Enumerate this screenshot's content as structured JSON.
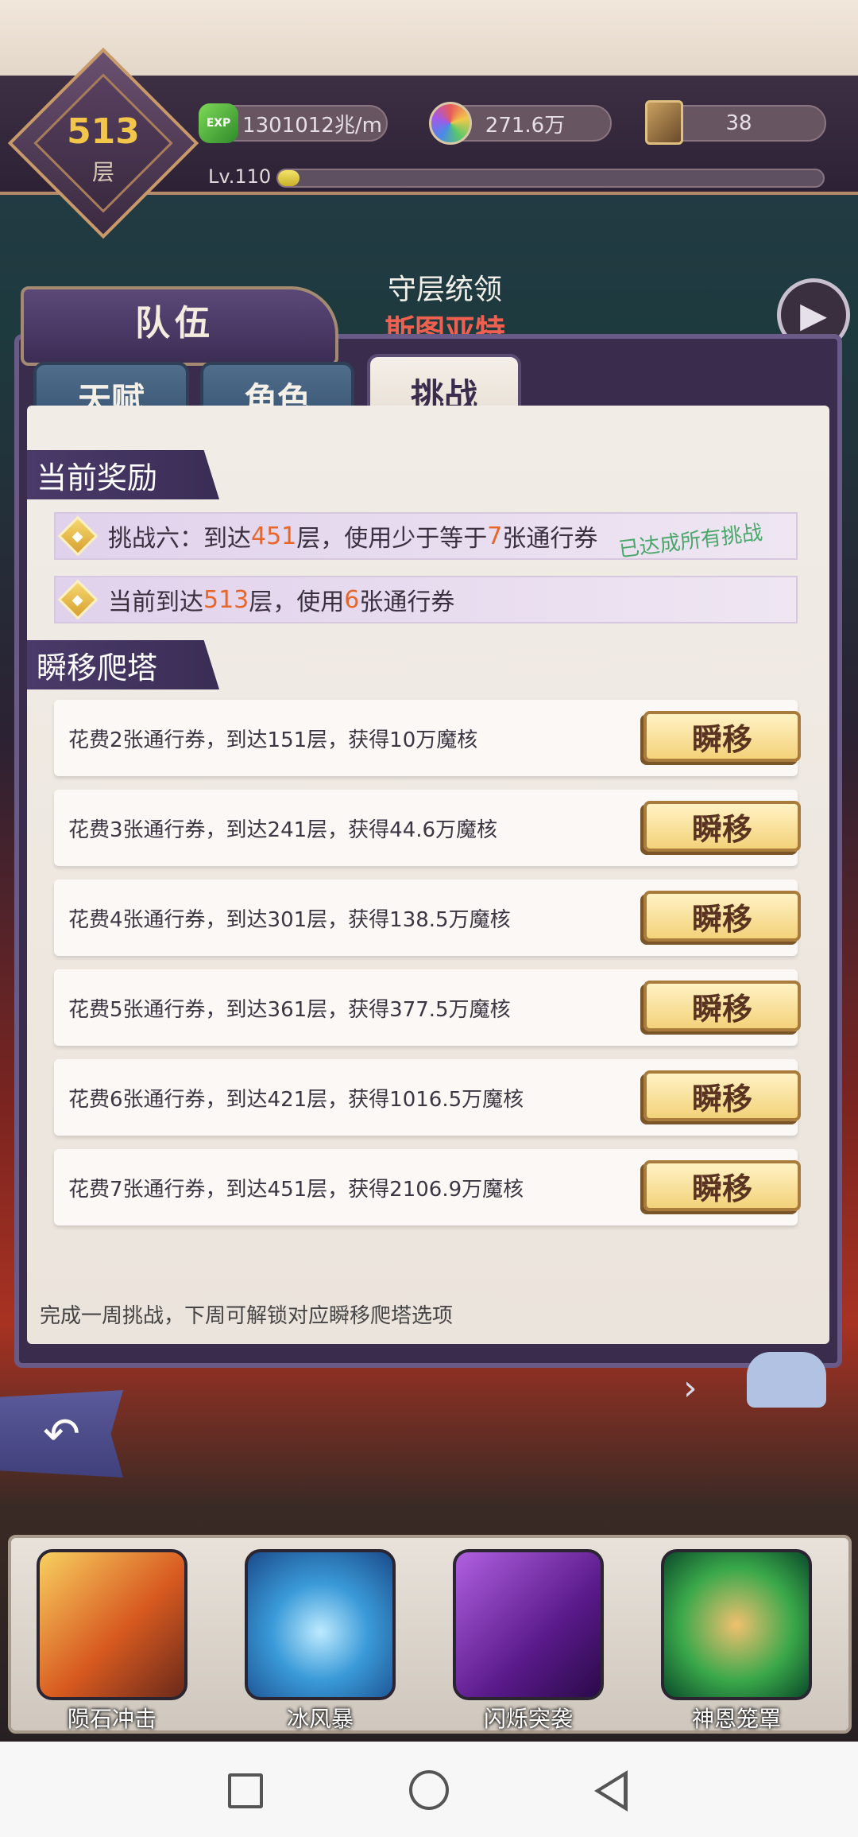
{
  "hud": {
    "floor_number": "513",
    "floor_label": "层",
    "exp_icon_text": "EXP",
    "exp_rate": "1301012兆/m",
    "orb_value": "271.6万",
    "ticket_count": "38",
    "level_text": "Lv.110",
    "level_progress": 0.04
  },
  "background": {
    "boss_title": "守层统领",
    "boss_name": "斯图亚特"
  },
  "panel": {
    "title": "队伍",
    "tabs": [
      "天赋",
      "角色",
      "挑战"
    ],
    "active_tab": "挑战"
  },
  "current_reward": {
    "heading": "当前奖励",
    "challenge": {
      "prefix": "挑战六：到达",
      "floor": "451",
      "mid": "层，使用少于等于",
      "count": "7",
      "suffix": "张通行券",
      "status": "已达成所有挑战"
    },
    "current": {
      "prefix": "当前到达",
      "floor": "513",
      "mid": "层，使用",
      "count": "6",
      "suffix": "张通行券"
    }
  },
  "teleport": {
    "heading": "瞬移爬塔",
    "button_label": "瞬移",
    "rows": [
      "花费2张通行券，到达151层，获得10万魔核",
      "花费3张通行券，到达241层，获得44.6万魔核",
      "花费4张通行券，到达301层，获得138.5万魔核",
      "花费5张通行券，到达361层，获得377.5万魔核",
      "花费6张通行券，到达421层，获得1016.5万魔核",
      "花费7张通行券，到达451层，获得2106.9万魔核"
    ],
    "footer_note": "完成一周挑战，下周可解锁对应瞬移爬塔选项"
  },
  "skills": [
    "陨石冲击",
    "冰风暴",
    "闪烁突袭",
    "神恩笼罩"
  ],
  "colors": {
    "accent_orange": "#e8662a",
    "done_green": "#4aa86a",
    "panel_purple": "#3a2d55"
  }
}
